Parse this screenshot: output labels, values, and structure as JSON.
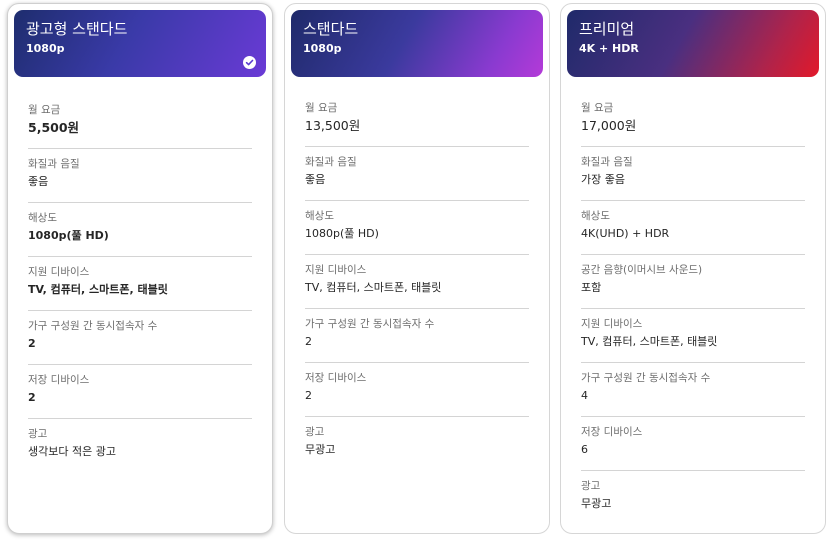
{
  "plans": [
    {
      "name": "광고형 스탠다드",
      "resolution": "1080p",
      "features": [
        {
          "label": "월 요금",
          "value": "5,500원"
        },
        {
          "label": "화질과 음질",
          "value": "좋음"
        },
        {
          "label": "해상도",
          "value": "1080p(풀 HD)"
        },
        {
          "label": "지원 디바이스",
          "value": "TV, 컴퓨터, 스마트폰, 태블릿"
        },
        {
          "label": "가구 구성원 간 동시접속자 수",
          "value": "2"
        },
        {
          "label": "저장 디바이스",
          "value": "2"
        },
        {
          "label": "광고",
          "value": "생각보다 적은 광고"
        }
      ]
    },
    {
      "name": "스탠다드",
      "resolution": "1080p",
      "features": [
        {
          "label": "월 요금",
          "value": "13,500원"
        },
        {
          "label": "화질과 음질",
          "value": "좋음"
        },
        {
          "label": "해상도",
          "value": "1080p(풀 HD)"
        },
        {
          "label": "지원 디바이스",
          "value": "TV, 컴퓨터, 스마트폰, 태블릿"
        },
        {
          "label": "가구 구성원 간 동시접속자 수",
          "value": "2"
        },
        {
          "label": "저장 디바이스",
          "value": "2"
        },
        {
          "label": "광고",
          "value": "무광고"
        }
      ]
    },
    {
      "name": "프리미엄",
      "resolution": "4K + HDR",
      "features": [
        {
          "label": "월 요금",
          "value": "17,000원"
        },
        {
          "label": "화질과 음질",
          "value": "가장 좋음"
        },
        {
          "label": "해상도",
          "value": "4K(UHD) + HDR"
        },
        {
          "label": "공간 음향(이머시브 사운드)",
          "value": "포함"
        },
        {
          "label": "지원 디바이스",
          "value": "TV, 컴퓨터, 스마트폰, 태블릿"
        },
        {
          "label": "가구 구성원 간 동시접속자 수",
          "value": "4"
        },
        {
          "label": "저장 디바이스",
          "value": "6"
        },
        {
          "label": "광고",
          "value": "무광고"
        }
      ]
    }
  ],
  "selected_plan": "광고형 스탠다드",
  "icons": {
    "selected": "check-circle-icon"
  },
  "colors": {
    "standard_with_ads_gradient": [
      "#1e2d6e",
      "#6a3ad6"
    ],
    "standard_gradient": [
      "#1f2a6a",
      "#b43ad8"
    ],
    "premium_gradient": [
      "#1f2a6a",
      "#e2192a"
    ]
  }
}
